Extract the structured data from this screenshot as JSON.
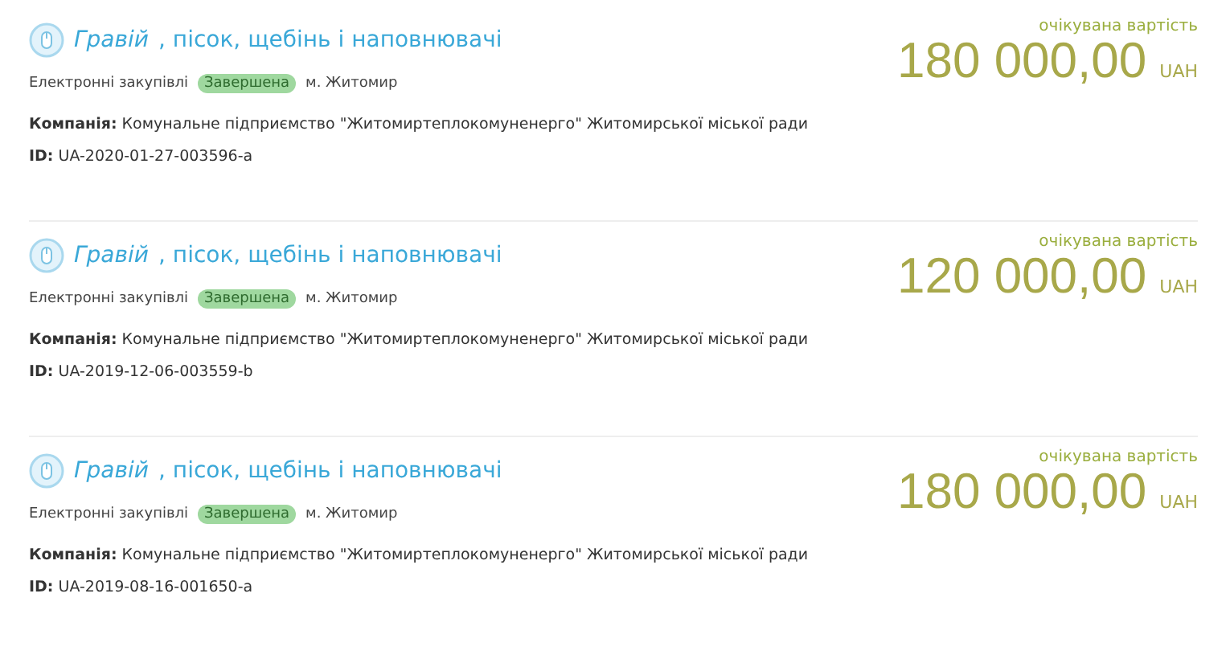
{
  "tenders": [
    {
      "title_highlight": "Гравій",
      "title_rest": ", пісок, щебінь і наповнювачі",
      "procedure": "Електронні закупівлі",
      "status": "Завершена",
      "city": "м. Житомир",
      "company_label": "Компанія:",
      "company": "Комунальне підприємство \"Житомиртеплокомуненерго\" Житомирської міської ради",
      "id_label": "ID:",
      "id": "UA-2020-01-27-003596-a",
      "price_label": "очікувана вартість",
      "amount": "180 000,00",
      "currency": "UAH"
    },
    {
      "title_highlight": "Гравій",
      "title_rest": ", пісок, щебінь і наповнювачі",
      "procedure": "Електронні закупівлі",
      "status": "Завершена",
      "city": "м. Житомир",
      "company_label": "Компанія:",
      "company": "Комунальне підприємство \"Житомиртеплокомуненерго\" Житомирської міської ради",
      "id_label": "ID:",
      "id": "UA-2019-12-06-003559-b",
      "price_label": "очікувана вартість",
      "amount": "120 000,00",
      "currency": "UAH"
    },
    {
      "title_highlight": "Гравій",
      "title_rest": ", пісок, щебінь і наповнювачі",
      "procedure": "Електронні закупівлі",
      "status": "Завершена",
      "city": "м. Житомир",
      "company_label": "Компанія:",
      "company": "Комунальне підприємство \"Житомиртеплокомуненерго\" Житомирської міської ради",
      "id_label": "ID:",
      "id": "UA-2019-08-16-001650-a",
      "price_label": "очікувана вартість",
      "amount": "180 000,00",
      "currency": "UAH"
    }
  ]
}
